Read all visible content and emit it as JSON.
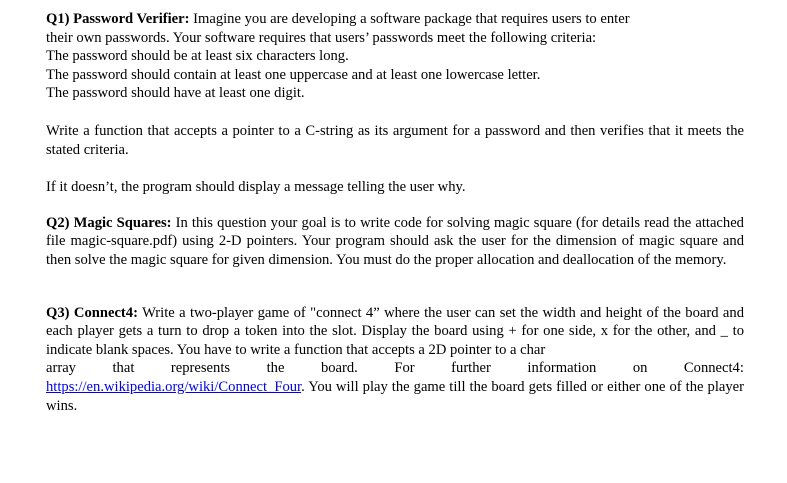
{
  "q1": {
    "heading": "Q1) Password Verifier:",
    "intro_line1": " Imagine you are developing a software package that requires users to enter",
    "intro_line2": "their own passwords. Your software requires that users’ passwords meet the following criteria:",
    "criteria": [
      "The password should be at least six characters long.",
      "The password should contain at least one uppercase and at least one lowercase letter.",
      "The password should have at least one digit."
    ],
    "task": "Write a function that accepts a pointer to a C-string as its argument for a password and then verifies that it meets the stated criteria.",
    "message": "If it doesn’t, the program should display a message telling the user why."
  },
  "q2": {
    "heading": "Q2) Magic Squares:",
    "body": " In this question your goal is to write code for solving magic square (for details read the attached file magic-square.pdf) using 2-D pointers. Your program should ask the user for the dimension of magic square and then solve the magic square for given dimension. You must do the proper allocation and deallocation of the memory."
  },
  "q3": {
    "heading": "Q3) Connect4:",
    "body": " Write a two-player game of \"connect 4” where the user can set the width and height of the board and each player gets a turn to drop a token into the slot. Display the board using + for one side, x for the other, and _ to indicate blank spaces. You have to write a function that accepts a 2D pointer to a char",
    "spread_words": [
      "array",
      "that",
      "represents",
      "the",
      "board.",
      "For",
      "further",
      "information",
      "on",
      "Connect4:"
    ],
    "link": "https://en.wikipedia.org/wiki/Connect_Four",
    "tail": ". You will play the game till the board gets filled or either one of the player wins."
  }
}
